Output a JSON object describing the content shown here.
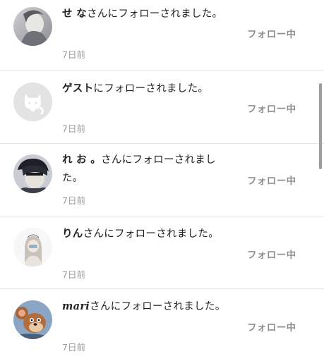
{
  "notifications": [
    {
      "avatar_icon": "user-photo-gray-icon",
      "username": "せ な",
      "message": "さんにフォローされました。",
      "time": "7日前",
      "action_label": "フォロー中"
    },
    {
      "avatar_icon": "guest-cat-icon",
      "username": "ゲスト",
      "message": "にフォローされました。",
      "time": "7日前",
      "action_label": "フォロー中"
    },
    {
      "avatar_icon": "user-photo-dark-icon",
      "username": "れ お 。",
      "message": "さんにフォローされました。",
      "time": "7日前",
      "action_label": "フォロー中"
    },
    {
      "avatar_icon": "user-illustration-icon",
      "username": "りん",
      "message": "さんにフォローされました。",
      "time": "7日前",
      "action_label": "フォロー中"
    },
    {
      "avatar_icon": "cartoon-mouse-icon",
      "username": "mari",
      "message": "さんにフォローされました。",
      "time": "7日前",
      "action_label": "フォロー中"
    }
  ],
  "colors": {
    "text": "#222222",
    "muted": "#9a9a9a",
    "button_text": "#8f8f8f",
    "divider": "#e6e6e6",
    "guest_avatar_bg": "#e3e3e3"
  }
}
